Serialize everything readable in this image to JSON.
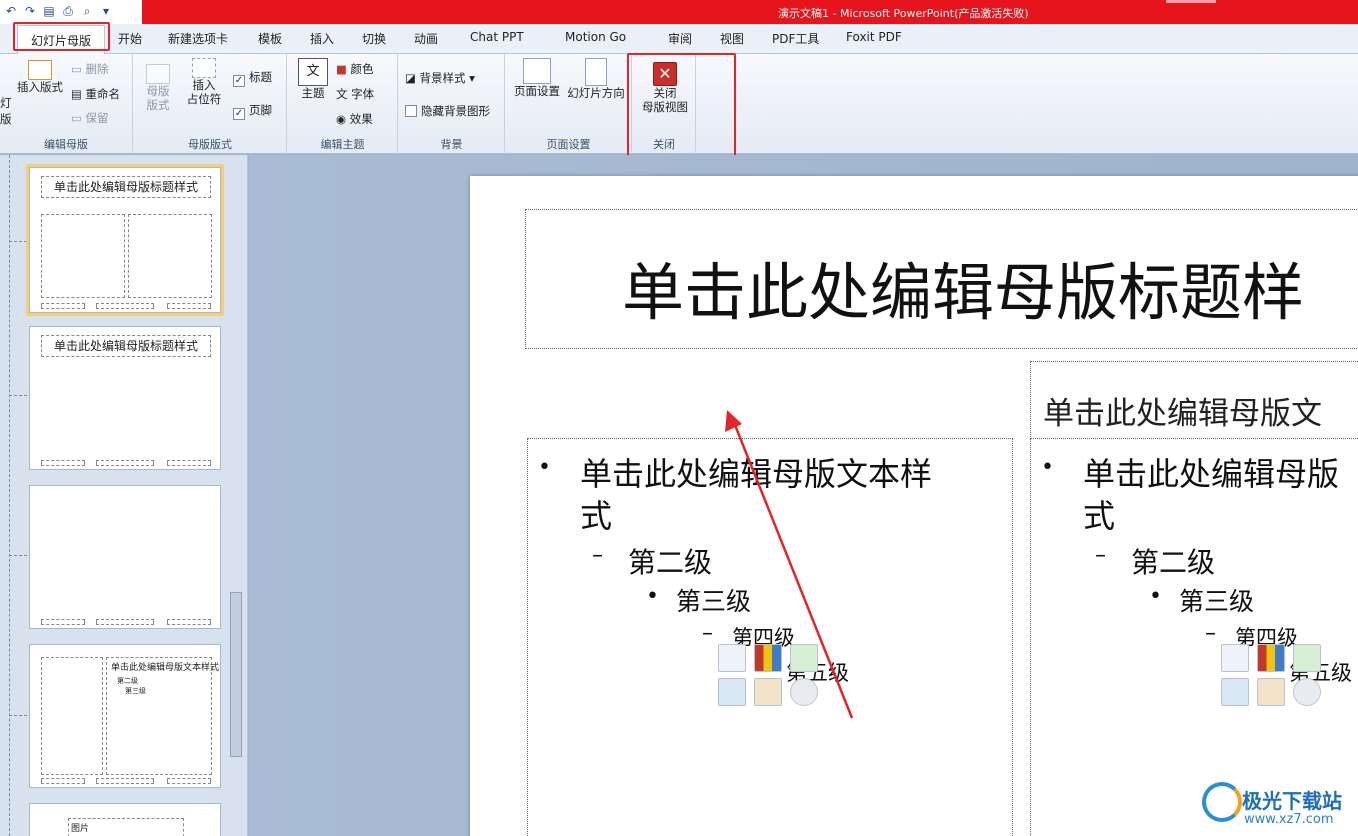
{
  "window": {
    "title": "演示文稿1 - Microsoft PowerPoint(产品激活失败)"
  },
  "quick_access": [
    "undo-icon",
    "redo-icon",
    "save-icon",
    "print-icon",
    "print-preview-icon",
    "customize-icon"
  ],
  "tabs": [
    {
      "label": "幻灯片母版",
      "active": true
    },
    {
      "label": "开始"
    },
    {
      "label": "新建选项卡"
    },
    {
      "label": "模板"
    },
    {
      "label": "插入"
    },
    {
      "label": "切换"
    },
    {
      "label": "动画"
    },
    {
      "label": "Chat PPT"
    },
    {
      "label": "Motion Go"
    },
    {
      "label": "审阅"
    },
    {
      "label": "视图"
    },
    {
      "label": "PDF工具"
    },
    {
      "label": "Foxit PDF"
    }
  ],
  "ribbon": {
    "edit_master": {
      "label": "编辑母版",
      "insert_slide_master_1": "灯",
      "insert_slide_master_2": "版",
      "insert_layout": "插入版式",
      "delete": "删除",
      "rename": "重命名",
      "preserve": "保留"
    },
    "master_layout": {
      "label": "母版版式",
      "master_layout_btn_1": "母版",
      "master_layout_btn_2": "版式",
      "insert_placeholder_1": "插入",
      "insert_placeholder_2": "占位符",
      "title_check": "标题",
      "footer_check": "页脚"
    },
    "edit_theme": {
      "label": "编辑主题",
      "themes": "主题",
      "colors": "颜色",
      "fonts": "字体",
      "effects": "效果"
    },
    "background": {
      "label": "背景",
      "background_styles": "背景样式",
      "hide_background": "隐藏背景图形"
    },
    "page_setup": {
      "label": "页面设置",
      "page_setup_btn": "页面设置",
      "slide_orientation": "幻灯片方向"
    },
    "close": {
      "label": "关闭",
      "close_master_1": "关闭",
      "close_master_2": "母版视图"
    }
  },
  "thumbnails": {
    "t1_title": "单击此处编辑母版标题样式",
    "t2_title": "单击此处编辑母版标题样式",
    "t4_body": "单击此处编辑母版文本样式",
    "t4_l2": "第二级",
    "t4_l3": "第三级",
    "t5_label": "图片"
  },
  "slide": {
    "title": "单击此处编辑母版标题样",
    "right_heading": "单击此处编辑母版文",
    "left_body": {
      "l1a": "单击此处编辑母版文本样",
      "l1b": "式",
      "l2": "第二级",
      "l3": "第三级",
      "l4": "第四级",
      "l5": "第五级"
    },
    "right_body": {
      "l1a": "单击此处编辑母版",
      "l1b": "式",
      "l2": "第二级",
      "l3": "第三级",
      "l4": "第四级",
      "l5": "第五级"
    }
  },
  "watermark": {
    "name": "极光下载站",
    "url": "www.xz7.com"
  },
  "colors": {
    "title_bar": "#e8141c",
    "highlight_box": "#e0262b",
    "canvas": "#9fb3cc"
  }
}
